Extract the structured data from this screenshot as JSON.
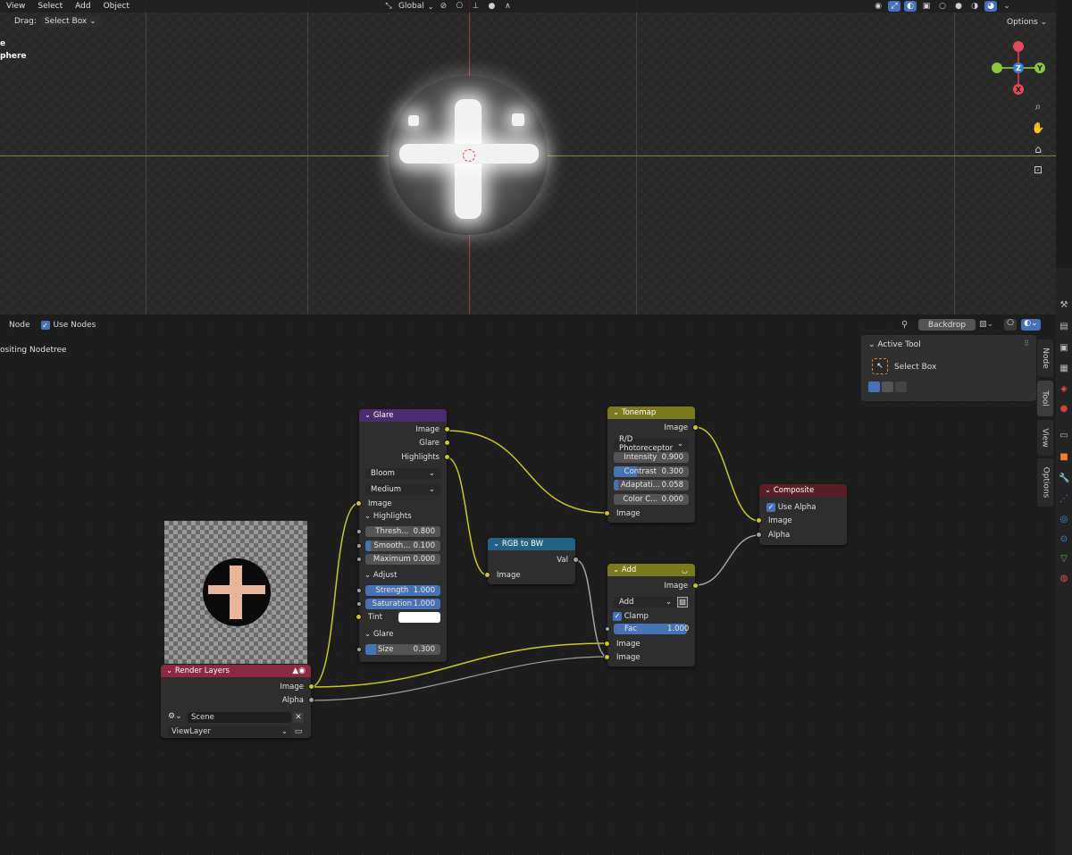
{
  "viewport": {
    "menu": [
      "View",
      "Select",
      "Add",
      "Object"
    ],
    "drag_label": "Drag:",
    "drag_value": "Select Box",
    "transform_orientation": "Global",
    "options_label": "Options",
    "scene_labels": [
      "e",
      "phere"
    ],
    "gizmo": {
      "x": "X",
      "y": "Y",
      "z": "Z"
    }
  },
  "node_editor": {
    "header": {
      "node_menu": "Node",
      "use_nodes_label": "Use Nodes",
      "backdrop_label": "Backdrop"
    },
    "tree_label": "ositing Nodetree",
    "tool_panel": {
      "title": "Active Tool",
      "tool_name": "Select Box"
    },
    "side_tabs": [
      "Node",
      "Tool",
      "View",
      "Options"
    ],
    "nodes": {
      "glare": {
        "title": "Glare",
        "outputs": [
          "Image",
          "Glare",
          "Highlights"
        ],
        "type": "Bloom",
        "quality": "Medium",
        "input_image": "Image",
        "highlights_header": "Highlights",
        "threshold": {
          "label": "Thresh...",
          "value": "0.800"
        },
        "smoothness": {
          "label": "Smooth...",
          "value": "0.100"
        },
        "maximum": {
          "label": "Maximum",
          "value": "0.000"
        },
        "adjust_header": "Adjust",
        "strength": {
          "label": "Strength",
          "value": "1.000"
        },
        "saturation": {
          "label": "Saturation",
          "value": "1.000"
        },
        "tint_label": "Tint",
        "glare_header": "Glare",
        "size": {
          "label": "Size",
          "value": "0.300"
        }
      },
      "tonemap": {
        "title": "Tonemap",
        "output": "Image",
        "method": "R/D Photoreceptor",
        "intensity": {
          "label": "Intensity",
          "value": "0.900"
        },
        "contrast": {
          "label": "Contrast",
          "value": "0.300"
        },
        "adaptation": {
          "label": "Adaptati...",
          "value": "0.058"
        },
        "color_correction": {
          "label": "Color C...",
          "value": "0.000"
        },
        "input": "Image"
      },
      "rgb_to_bw": {
        "title": "RGB to BW",
        "output": "Val",
        "input": "Image"
      },
      "add": {
        "title": "Add",
        "output": "Image",
        "blend": "Add",
        "clamp_label": "Clamp",
        "fac": {
          "label": "Fac",
          "value": "1.000"
        },
        "input1": "Image",
        "input2": "Image"
      },
      "composite": {
        "title": "Composite",
        "use_alpha_label": "Use Alpha",
        "input_image": "Image",
        "input_alpha": "Alpha"
      },
      "render_layers": {
        "title": "Render Layers",
        "output_image": "Image",
        "output_alpha": "Alpha",
        "scene": "Scene",
        "view_layer": "ViewLayer"
      }
    }
  }
}
